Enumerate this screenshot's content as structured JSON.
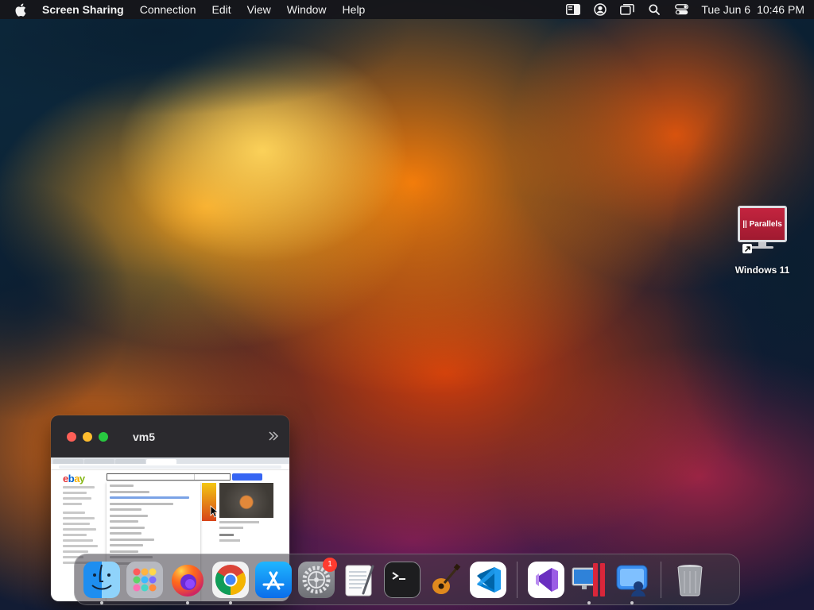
{
  "menubar": {
    "app_name": "Screen Sharing",
    "menus": [
      "Connection",
      "Edit",
      "View",
      "Window",
      "Help"
    ],
    "status_icons": [
      "stage-manager-icon",
      "user-account-icon",
      "screen-mirroring-icon",
      "search-icon",
      "control-center-icon"
    ],
    "date": "Tue Jun 6",
    "time": "10:46 PM"
  },
  "desktop": {
    "icon_label": "Windows 11",
    "screen_text": "|| Parallels"
  },
  "window": {
    "title": "vm5"
  },
  "dock": {
    "items": [
      {
        "name": "finder",
        "running": true
      },
      {
        "name": "launchpad",
        "running": false
      },
      {
        "name": "firefox",
        "running": true
      },
      {
        "name": "chrome",
        "running": true
      },
      {
        "name": "app-store",
        "running": false
      },
      {
        "name": "system-settings",
        "running": false,
        "badge": "1"
      },
      {
        "name": "textedit",
        "running": false
      },
      {
        "name": "terminal",
        "running": false
      },
      {
        "name": "garageband",
        "running": false
      },
      {
        "name": "vscode",
        "running": false
      },
      {
        "name": "visual-studio",
        "running": false
      },
      {
        "name": "parallels-desktop",
        "running": true
      },
      {
        "name": "screen-sharing",
        "running": true
      },
      {
        "name": "trash",
        "running": false
      }
    ]
  },
  "colors": {
    "menubar_bg": "#16161a",
    "traffic_red": "#fe5f57",
    "traffic_yellow": "#febc2e",
    "traffic_green": "#28c840",
    "badge": "#ff3b30",
    "parallels_red": "#c3243f"
  }
}
